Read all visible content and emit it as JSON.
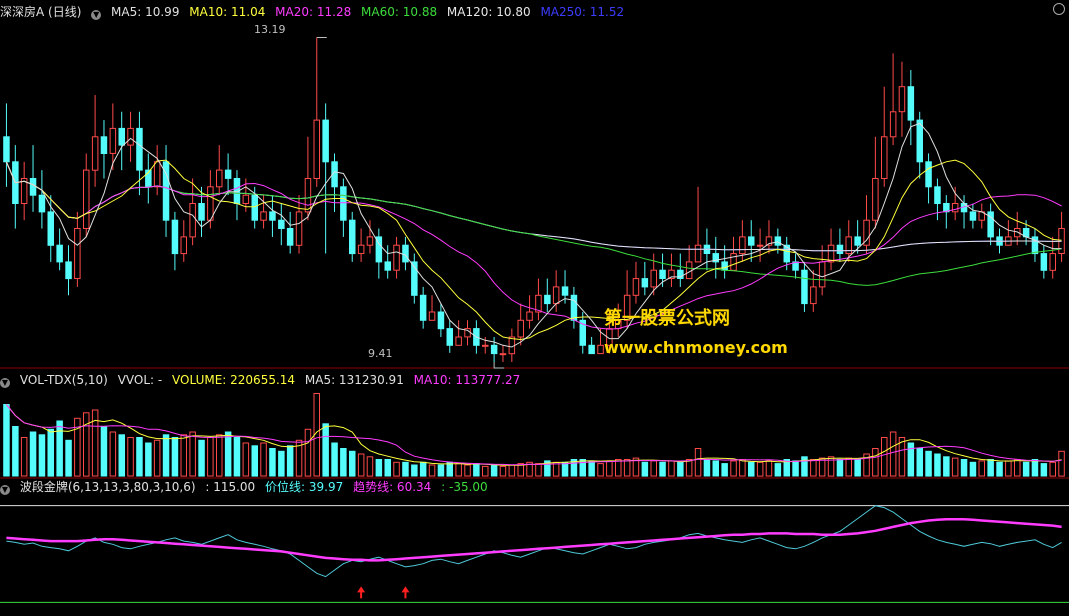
{
  "main_header": {
    "title": "深深房A (日线)",
    "ma5": "MA5: 10.99",
    "ma10": "MA10: 11.04",
    "ma20": "MA20: 11.28",
    "ma60": "MA60: 10.88",
    "ma120": "MA120: 10.80",
    "ma250": "MA250: 11.52"
  },
  "vol_header": {
    "name": "VOL-TDX(5,10)",
    "vvol": "VVOL: -",
    "volume": "VOLUME: 220655.14",
    "ma5": "MA5: 131230.91",
    "ma10": "MA10: 113777.27"
  },
  "ind_header": {
    "name": "波段金牌(6,13,13,3,80,3,10,6)",
    "value": ": 115.00",
    "price_line": "价位线: 39.97",
    "trend_line": "趋势线: 60.34",
    "extra": ": -35.00"
  },
  "price_marks": {
    "high": "13.19",
    "low": "9.41"
  },
  "watermark": {
    "line1": "第一股票公式网",
    "line2": "www.chnmoney.com"
  },
  "colors": {
    "background": "#000000",
    "up": "#ff4a4a",
    "down": "#54fcfc",
    "ma5": "#e0e0e0",
    "ma10": "#ffff3c",
    "ma20": "#ff3cff",
    "ma60": "#3cdc3c",
    "ma120": "#e8e8e8",
    "ma250": "#3c3cff",
    "divider": "#8b0000"
  },
  "chart_data": {
    "type": "candlestick",
    "price_range": [
      9.3,
      13.4
    ],
    "candles": [
      [
        12.0,
        11.7,
        12.4,
        11.4
      ],
      [
        11.7,
        11.2,
        11.9,
        10.9
      ],
      [
        11.2,
        11.5,
        11.7,
        11.0
      ],
      [
        11.5,
        11.3,
        11.9,
        11.1
      ],
      [
        11.3,
        11.1,
        11.6,
        10.9
      ],
      [
        11.1,
        10.7,
        11.3,
        10.5
      ],
      [
        10.7,
        10.5,
        10.9,
        10.4
      ],
      [
        10.5,
        10.3,
        10.7,
        10.1
      ],
      [
        10.3,
        10.9,
        11.1,
        10.2
      ],
      [
        10.9,
        11.6,
        11.8,
        10.8
      ],
      [
        11.6,
        12.0,
        12.5,
        11.4
      ],
      [
        12.0,
        11.8,
        12.2,
        11.5
      ],
      [
        11.8,
        12.1,
        12.4,
        11.6
      ],
      [
        12.1,
        11.9,
        12.3,
        11.6
      ],
      [
        11.9,
        12.1,
        12.3,
        11.7
      ],
      [
        12.1,
        11.6,
        12.3,
        11.3
      ],
      [
        11.6,
        11.4,
        11.8,
        11.2
      ],
      [
        11.4,
        11.7,
        11.9,
        11.3
      ],
      [
        11.7,
        11.0,
        11.9,
        10.8
      ],
      [
        11.0,
        10.6,
        11.1,
        10.4
      ],
      [
        10.6,
        10.8,
        11.0,
        10.5
      ],
      [
        10.8,
        11.2,
        11.5,
        10.7
      ],
      [
        11.2,
        11.0,
        11.4,
        10.8
      ],
      [
        11.0,
        11.4,
        11.6,
        10.9
      ],
      [
        11.4,
        11.6,
        11.9,
        11.3
      ],
      [
        11.6,
        11.5,
        11.8,
        11.3
      ],
      [
        11.5,
        11.2,
        11.6,
        11.0
      ],
      [
        11.2,
        11.3,
        11.5,
        11.1
      ],
      [
        11.3,
        11.0,
        11.4,
        10.9
      ],
      [
        11.0,
        11.1,
        11.3,
        10.9
      ],
      [
        11.1,
        11.0,
        11.3,
        10.8
      ],
      [
        11.0,
        10.9,
        11.2,
        10.7
      ],
      [
        10.9,
        10.7,
        11.1,
        10.6
      ],
      [
        10.7,
        11.1,
        11.3,
        10.6
      ],
      [
        11.1,
        11.5,
        12.0,
        11.0
      ],
      [
        11.5,
        12.2,
        13.19,
        11.4
      ],
      [
        12.2,
        11.7,
        12.4,
        10.6
      ],
      [
        11.7,
        11.4,
        11.8,
        11.1
      ],
      [
        11.4,
        11.0,
        11.5,
        10.8
      ],
      [
        11.0,
        10.6,
        11.1,
        10.5
      ],
      [
        10.6,
        10.7,
        10.9,
        10.5
      ],
      [
        10.7,
        10.8,
        11.0,
        10.6
      ],
      [
        10.8,
        10.5,
        10.9,
        10.3
      ],
      [
        10.5,
        10.4,
        10.7,
        10.3
      ],
      [
        10.4,
        10.7,
        10.8,
        10.3
      ],
      [
        10.7,
        10.5,
        10.8,
        10.4
      ],
      [
        10.5,
        10.1,
        10.6,
        10.0
      ],
      [
        10.1,
        9.8,
        10.2,
        9.7
      ],
      [
        9.8,
        9.9,
        10.1,
        9.8
      ],
      [
        9.9,
        9.7,
        10.0,
        9.6
      ],
      [
        9.7,
        9.5,
        9.8,
        9.41
      ],
      [
        9.5,
        9.6,
        9.8,
        9.5
      ],
      [
        9.6,
        9.7,
        9.8,
        9.5
      ],
      [
        9.7,
        9.5,
        9.8,
        9.4
      ],
      [
        9.5,
        9.5,
        9.6,
        9.4
      ],
      [
        9.5,
        9.4,
        9.6,
        9.3
      ],
      [
        9.4,
        9.4,
        9.5,
        9.3
      ],
      [
        9.4,
        9.6,
        9.7,
        9.3
      ],
      [
        9.6,
        9.8,
        10.0,
        9.5
      ],
      [
        9.8,
        9.9,
        10.1,
        9.7
      ],
      [
        9.9,
        10.1,
        10.3,
        9.8
      ],
      [
        10.1,
        10.0,
        10.3,
        9.9
      ],
      [
        10.0,
        10.2,
        10.4,
        9.9
      ],
      [
        10.2,
        10.1,
        10.4,
        10.0
      ],
      [
        10.1,
        9.8,
        10.2,
        9.7
      ],
      [
        9.8,
        9.5,
        9.9,
        9.4
      ],
      [
        9.5,
        9.4,
        9.6,
        9.4
      ],
      [
        9.4,
        9.5,
        9.7,
        9.4
      ],
      [
        9.5,
        9.7,
        9.9,
        9.4
      ],
      [
        9.7,
        9.8,
        10.0,
        9.6
      ],
      [
        9.8,
        10.1,
        10.4,
        9.7
      ],
      [
        10.1,
        10.3,
        10.5,
        10.0
      ],
      [
        10.3,
        10.2,
        10.5,
        10.1
      ],
      [
        10.2,
        10.4,
        10.6,
        10.1
      ],
      [
        10.4,
        10.3,
        10.6,
        10.2
      ],
      [
        10.3,
        10.4,
        10.6,
        10.2
      ],
      [
        10.4,
        10.3,
        10.6,
        10.2
      ],
      [
        10.3,
        10.5,
        10.7,
        10.3
      ],
      [
        10.5,
        10.7,
        11.4,
        10.5
      ],
      [
        10.7,
        10.6,
        10.9,
        10.4
      ],
      [
        10.6,
        10.5,
        10.8,
        10.3
      ],
      [
        10.5,
        10.4,
        10.7,
        10.3
      ],
      [
        10.4,
        10.6,
        10.8,
        10.4
      ],
      [
        10.6,
        10.8,
        11.0,
        10.5
      ],
      [
        10.8,
        10.7,
        11.0,
        10.5
      ],
      [
        10.7,
        10.7,
        10.9,
        10.5
      ],
      [
        10.7,
        10.8,
        11.0,
        10.6
      ],
      [
        10.8,
        10.7,
        10.9,
        10.6
      ],
      [
        10.7,
        10.5,
        10.8,
        10.4
      ],
      [
        10.5,
        10.4,
        10.6,
        10.3
      ],
      [
        10.4,
        10.0,
        10.5,
        9.9
      ],
      [
        10.0,
        10.2,
        10.4,
        9.9
      ],
      [
        10.2,
        10.5,
        10.7,
        10.1
      ],
      [
        10.5,
        10.7,
        10.9,
        10.4
      ],
      [
        10.7,
        10.6,
        10.9,
        10.5
      ],
      [
        10.6,
        10.8,
        11.0,
        10.5
      ],
      [
        10.8,
        10.7,
        11.0,
        10.6
      ],
      [
        10.7,
        11.0,
        11.3,
        10.6
      ],
      [
        11.0,
        11.5,
        12.0,
        10.9
      ],
      [
        11.5,
        12.0,
        12.6,
        11.4
      ],
      [
        12.0,
        12.3,
        13.0,
        11.9
      ],
      [
        12.3,
        12.6,
        12.9,
        12.0
      ],
      [
        12.6,
        12.2,
        12.8,
        11.9
      ],
      [
        12.2,
        11.7,
        12.3,
        11.5
      ],
      [
        11.7,
        11.4,
        11.8,
        11.2
      ],
      [
        11.4,
        11.2,
        11.5,
        11.0
      ],
      [
        11.2,
        11.1,
        11.3,
        10.9
      ],
      [
        11.1,
        11.2,
        11.4,
        11.0
      ],
      [
        11.2,
        11.1,
        11.3,
        10.9
      ],
      [
        11.1,
        11.0,
        11.2,
        10.9
      ],
      [
        11.0,
        11.1,
        11.2,
        10.9
      ],
      [
        11.1,
        10.8,
        11.2,
        10.7
      ],
      [
        10.8,
        10.7,
        10.9,
        10.6
      ],
      [
        10.7,
        10.8,
        11.0,
        10.7
      ],
      [
        10.8,
        10.9,
        11.1,
        10.7
      ],
      [
        10.9,
        10.8,
        11.0,
        10.7
      ],
      [
        10.8,
        10.6,
        10.9,
        10.5
      ],
      [
        10.6,
        10.4,
        10.7,
        10.3
      ],
      [
        10.4,
        10.6,
        10.8,
        10.3
      ],
      [
        10.6,
        10.9,
        11.1,
        10.5
      ]
    ],
    "volume_range": [
      0,
      320000
    ],
    "volumes": [
      260000,
      180000,
      140000,
      160000,
      150000,
      170000,
      200000,
      130000,
      210000,
      230000,
      240000,
      180000,
      160000,
      150000,
      140000,
      140000,
      120000,
      130000,
      150000,
      140000,
      150000,
      160000,
      130000,
      140000,
      150000,
      160000,
      140000,
      120000,
      110000,
      120000,
      100000,
      90000,
      110000,
      130000,
      170000,
      300000,
      190000,
      120000,
      100000,
      90000,
      80000,
      70000,
      60000,
      60000,
      50000,
      50000,
      40000,
      50000,
      40000,
      40000,
      50000,
      45000,
      40000,
      45000,
      35000,
      40000,
      35000,
      40000,
      45000,
      50000,
      45000,
      55000,
      50000,
      50000,
      60000,
      60000,
      55000,
      45000,
      55000,
      60000,
      60000,
      65000,
      50000,
      55000,
      50000,
      55000,
      50000,
      60000,
      100000,
      60000,
      55000,
      45000,
      55000,
      60000,
      50000,
      50000,
      55000,
      45000,
      60000,
      55000,
      70000,
      60000,
      65000,
      70000,
      60000,
      65000,
      60000,
      80000,
      100000,
      140000,
      160000,
      140000,
      120000,
      100000,
      90000,
      80000,
      70000,
      65000,
      60000,
      50000,
      55000,
      60000,
      50000,
      55000,
      60000,
      50000,
      60000,
      45000,
      50000,
      90000
    ],
    "indicator_range": [
      -50,
      130
    ],
    "price_line": [
      60,
      58,
      55,
      57,
      52,
      50,
      48,
      45,
      52,
      60,
      65,
      58,
      55,
      50,
      48,
      52,
      55,
      58,
      62,
      65,
      60,
      58,
      55,
      60,
      65,
      70,
      62,
      58,
      55,
      52,
      48,
      45,
      40,
      30,
      20,
      10,
      5,
      15,
      25,
      30,
      28,
      32,
      35,
      30,
      25,
      20,
      22,
      25,
      30,
      32,
      28,
      25,
      30,
      35,
      40,
      45,
      42,
      38,
      35,
      40,
      45,
      50,
      48,
      45,
      42,
      40,
      45,
      50,
      55,
      52,
      48,
      50,
      55,
      58,
      60,
      62,
      65,
      70,
      72,
      68,
      65,
      62,
      60,
      58,
      62,
      65,
      60,
      55,
      50,
      48,
      52,
      58,
      65,
      70,
      75,
      85,
      95,
      105,
      115,
      112,
      105,
      95,
      85,
      75,
      68,
      62,
      58,
      55,
      52,
      55,
      58,
      56,
      52,
      55,
      58,
      60,
      62,
      55,
      50,
      58
    ],
    "trend_line": [
      65,
      64,
      63,
      62,
      61,
      60,
      60,
      60,
      60,
      61,
      62,
      63,
      63,
      62,
      61,
      60,
      59,
      58,
      57,
      56,
      55,
      54,
      53,
      52,
      51,
      50,
      49,
      48,
      47,
      46,
      45,
      44,
      42,
      40,
      38,
      36,
      34,
      33,
      32,
      31,
      31,
      30,
      30,
      31,
      32,
      33,
      34,
      35,
      36,
      37,
      38,
      39,
      40,
      41,
      42,
      43,
      44,
      45,
      46,
      47,
      48,
      49,
      50,
      51,
      52,
      53,
      54,
      55,
      56,
      57,
      58,
      59,
      60,
      61,
      62,
      63,
      64,
      65,
      66,
      67,
      68,
      69,
      70,
      70,
      71,
      71,
      72,
      72,
      72,
      71,
      71,
      71,
      70,
      70,
      70,
      71,
      72,
      74,
      76,
      79,
      82,
      85,
      88,
      90,
      92,
      93,
      94,
      94,
      94,
      93,
      92,
      91,
      90,
      89,
      88,
      87,
      86,
      85,
      84,
      82
    ],
    "markers": [
      "buy-arrow",
      "buy-arrow"
    ],
    "y_labels": [
      "13.19",
      "9.41"
    ]
  }
}
